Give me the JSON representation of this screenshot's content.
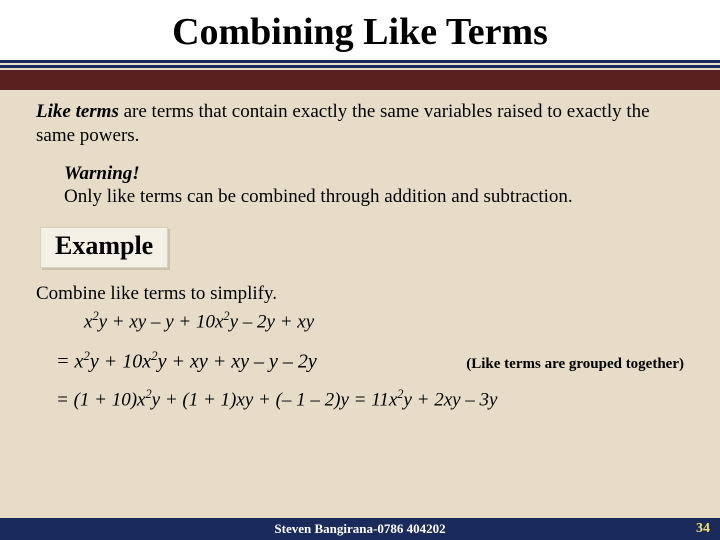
{
  "title": "Combining Like Terms",
  "definition": {
    "lead": "Like terms",
    "rest": " are terms that contain exactly the same variables raised to exactly the same powers."
  },
  "warning": {
    "heading": "Warning!",
    "body": "Only like terms can be combined through addition and subtraction."
  },
  "example_label": "Example",
  "prompt": "Combine like terms to simplify.",
  "expr1": "x²y + xy – y + 10x²y – 2y + xy",
  "step1": "= x²y + 10x²y + xy + xy – y – 2y",
  "step1_note": "(Like terms are grouped together)",
  "final": "= (1 + 10)x²y + (1 + 1)xy + (– 1 – 2)y = 11x²y + 2xy – 3y",
  "footer": "Steven Bangirana-0786 404202",
  "page": "34"
}
